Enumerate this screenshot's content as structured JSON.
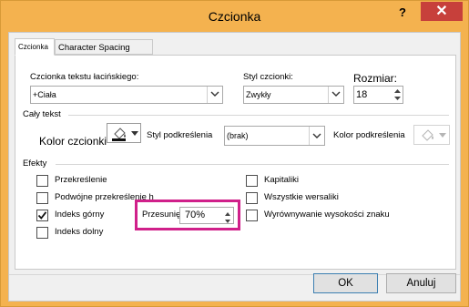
{
  "window": {
    "title": "Czcionka",
    "help_glyph": "?",
    "close_glyph": "✕",
    "title_bar_color": "#f4b24f",
    "close_color": "#c7403b"
  },
  "tabs": [
    {
      "label": "Czcionka"
    },
    {
      "label": "Character Spacing"
    }
  ],
  "font_section": {
    "latin_font_label": "Czcionka tekstu łacińskiego:",
    "latin_font_value": "+Ciała",
    "style_label": "Styl czcionki:",
    "style_value": "Zwykły",
    "size_label": "Rozmiar:",
    "size_value": "18"
  },
  "all_text": {
    "group_label": "Cały tekst",
    "font_color_label": "Kolor czcionki",
    "underline_style_label": "Styl podkreślenia",
    "underline_style_value": "(brak)",
    "underline_color_label": "Kolor podkreślenia"
  },
  "effects": {
    "group_label": "Efekty",
    "strikethrough": {
      "label": "Przekreślenie",
      "checked": false
    },
    "double_strikethrough": {
      "label": "Podwójne przekreślenie h",
      "checked": false
    },
    "superscript": {
      "label": "Indeks górny",
      "checked": true
    },
    "subscript": {
      "label": "Indeks dolny",
      "checked": false
    },
    "offset_label": "Przesunięcie:",
    "offset_value": "70%",
    "small_caps": {
      "label": "Kapitaliki",
      "checked": false
    },
    "all_caps": {
      "label": "Wszystkie wersaliki",
      "checked": false
    },
    "equalize_height": {
      "label": "Wyrównywanie wysokości znaku",
      "checked": false
    },
    "highlight_color": "#d0208a"
  },
  "footer": {
    "ok_label": "OK",
    "cancel_label": "Anuluj"
  }
}
